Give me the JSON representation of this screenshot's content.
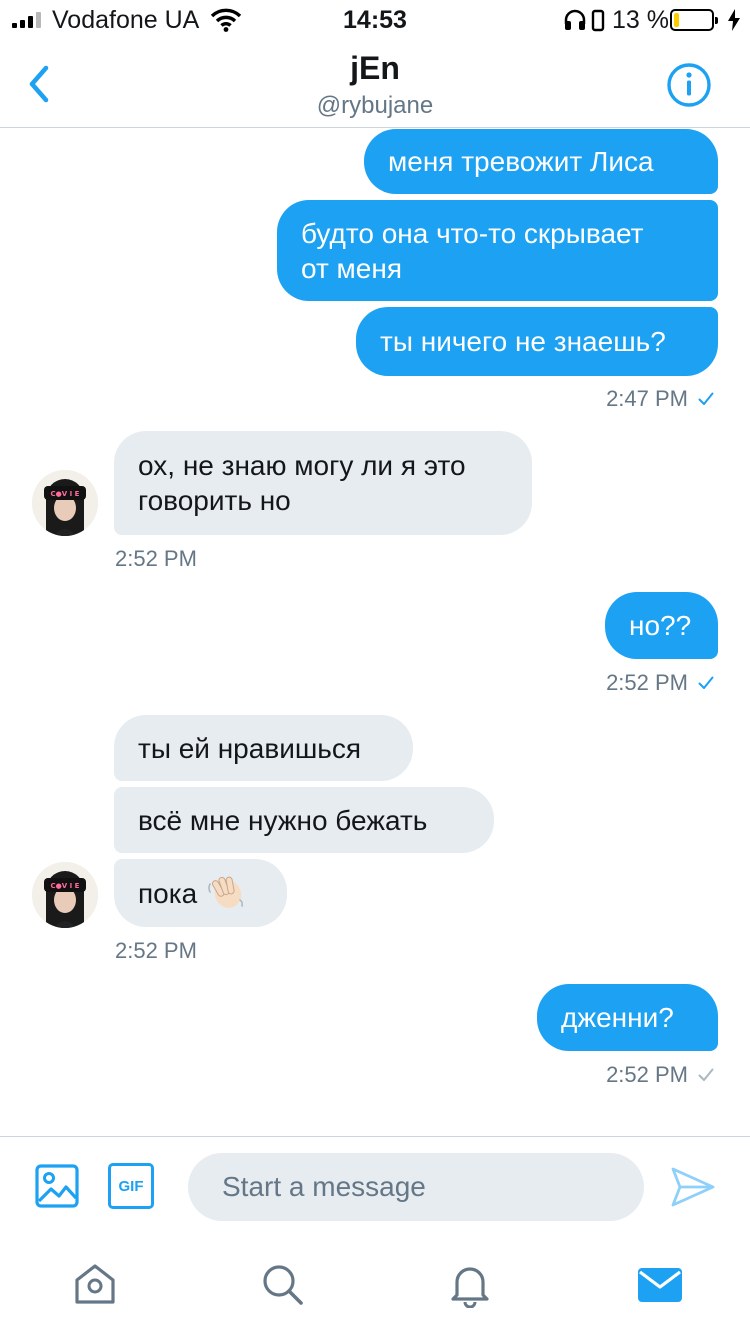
{
  "status_bar": {
    "carrier": "Vodafone UA",
    "time": "14:53",
    "battery_percent": "13 %",
    "battery_level": 0.13,
    "battery_color": "#fccb00"
  },
  "header": {
    "back_icon": "chevron-left-icon",
    "title": "jEn",
    "handle": "@rybujane",
    "info_icon": "info-icon"
  },
  "messages": [
    {
      "side": "out",
      "text": "меня тревожит Лиса"
    },
    {
      "side": "out",
      "text_line1": "будто она что-то скрывает",
      "text_line2": "от меня"
    },
    {
      "side": "out",
      "text": "ты ничего не знаешь?"
    },
    {
      "side": "out-meta",
      "time": "2:47 PM",
      "status_icon": "check-icon",
      "read": true
    },
    {
      "side": "in",
      "text_line1": "ох, не знаю могу ли я это",
      "text_line2": "говорить но"
    },
    {
      "side": "in-meta",
      "time": "2:52 PM"
    },
    {
      "side": "out",
      "text": "но??"
    },
    {
      "side": "out-meta",
      "time": "2:52 PM",
      "status_icon": "check-icon",
      "read": true
    },
    {
      "side": "in",
      "text": "ты ей нравишься"
    },
    {
      "side": "in",
      "text": "всё мне нужно бежать"
    },
    {
      "side": "in",
      "text": "пока",
      "emoji": "waving-hand"
    },
    {
      "side": "in-meta",
      "time": "2:52 PM"
    },
    {
      "side": "out",
      "text": "дженни?"
    },
    {
      "side": "out-meta",
      "time": "2:52 PM",
      "status_icon": "check-icon",
      "read": false
    }
  ],
  "composer": {
    "placeholder": "Start a message",
    "image_icon": "image-icon",
    "gif_label": "GIF",
    "send_icon": "send-icon"
  },
  "tabbar": {
    "items": [
      "home-icon",
      "search-icon",
      "notifications-icon",
      "messages-icon"
    ],
    "active": "messages-icon"
  },
  "colors": {
    "accent": "#1da1f2",
    "incoming_bubble": "#e6ecf0",
    "muted_text": "#657786"
  }
}
